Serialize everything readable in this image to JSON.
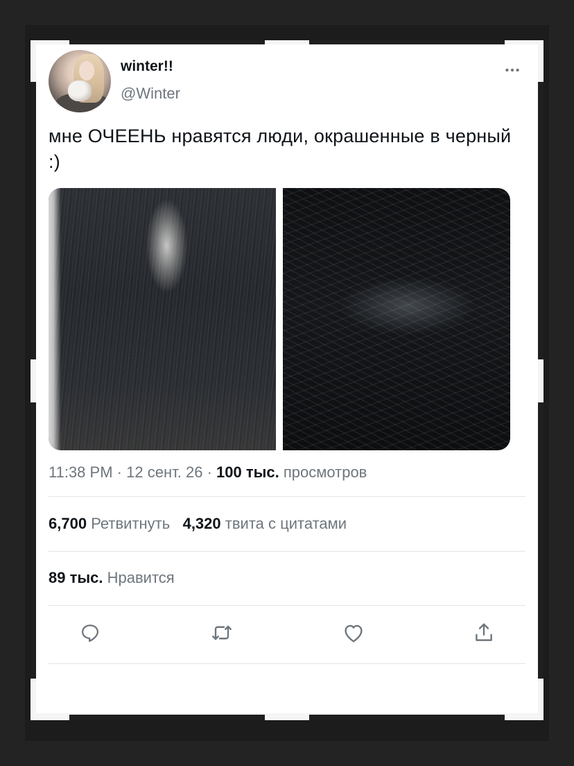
{
  "tweet": {
    "display_name": "winter!!",
    "handle": "@Winter",
    "text": "мне ОЧЕЕНЬ нравятся люди, окрашенные в черный :)",
    "time": "11:38 PM",
    "separator": "·",
    "date": "12 сент. 26",
    "views_count": "100 тыс.",
    "views_label": "просмотров"
  },
  "stats": {
    "retweets_count": "6,700",
    "retweets_label": "Ретвитнуть",
    "quotes_count": "4,320",
    "quotes_label": "твита с цитатами",
    "likes_count": "89 тыс.",
    "likes_label": "Нравится"
  },
  "icons": {
    "more": "more-horizontal-icon",
    "reply": "reply-icon",
    "retweet": "retweet-icon",
    "like": "heart-icon",
    "share": "share-icon"
  },
  "colors": {
    "text_primary": "#0f1419",
    "text_secondary": "#6e767d",
    "divider": "#e1e6ea",
    "background_frame": "#202020",
    "card": "#ffffff"
  }
}
